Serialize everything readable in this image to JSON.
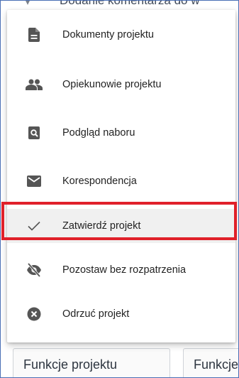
{
  "background": {
    "partial_text": "Dodanie komentarza do w"
  },
  "menu": {
    "items": [
      {
        "label": "Dokumenty projektu",
        "icon": "document-icon"
      },
      {
        "label": "Opiekunowie projektu",
        "icon": "people-icon"
      },
      {
        "label": "Podgląd naboru",
        "icon": "preview-search-icon"
      },
      {
        "label": "Korespondencja",
        "icon": "envelope-icon"
      },
      {
        "label": "Zatwierdź projekt",
        "icon": "check-icon",
        "highlighted": true
      },
      {
        "label": "Pozostaw bez rozpatrzenia",
        "icon": "eye-off-icon"
      },
      {
        "label": "Odrzuć projekt",
        "icon": "cancel-circle-icon"
      }
    ]
  },
  "bottom": {
    "button1_label": "Funkcje projektu",
    "button2_label": "Funkcje"
  },
  "colors": {
    "highlight_border": "#e0202a",
    "icon": "#555555",
    "text": "#222222",
    "frame": "#4a6fb5"
  }
}
